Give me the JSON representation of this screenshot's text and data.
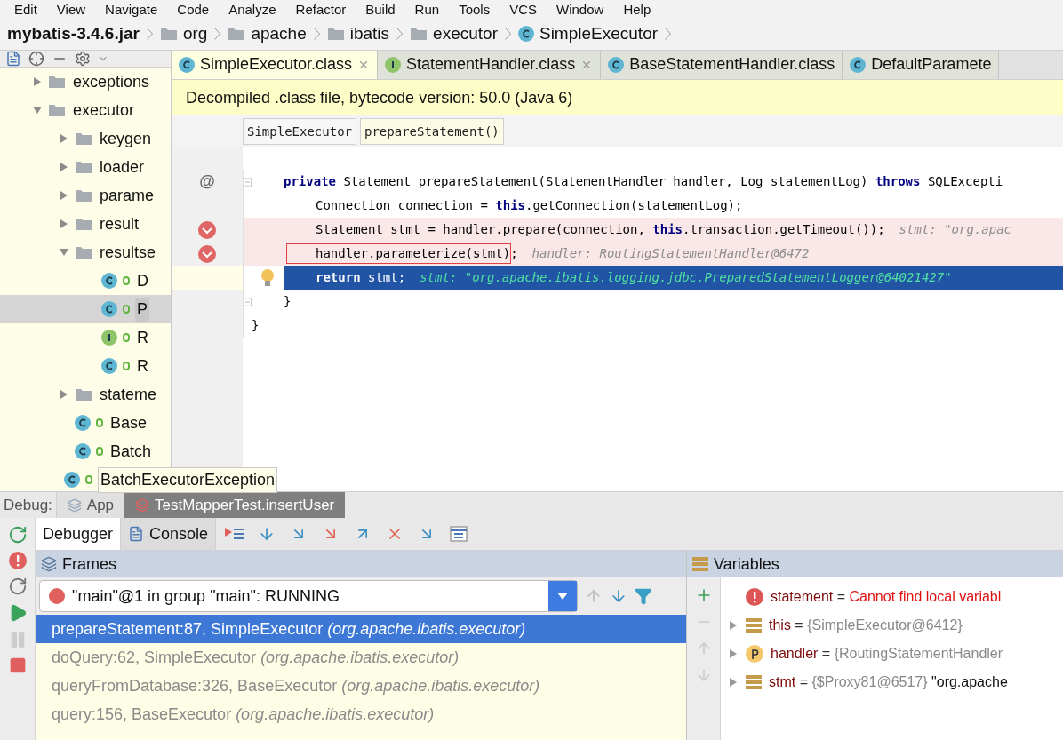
{
  "menu": [
    "Edit",
    "View",
    "Navigate",
    "Code",
    "Analyze",
    "Refactor",
    "Build",
    "Run",
    "Tools",
    "VCS",
    "Window",
    "Help"
  ],
  "breadcrumbs": [
    {
      "label": "mybatis-3.4.6.jar",
      "kind": "jar"
    },
    {
      "label": "org",
      "kind": "folder"
    },
    {
      "label": "apache",
      "kind": "folder"
    },
    {
      "label": "ibatis",
      "kind": "folder"
    },
    {
      "label": "executor",
      "kind": "folder"
    },
    {
      "label": "SimpleExecutor",
      "kind": "class"
    }
  ],
  "editor_tabs": [
    {
      "label": "SimpleExecutor.class",
      "kind": "class",
      "selected": true
    },
    {
      "label": "StatementHandler.class",
      "kind": "interface",
      "selected": false
    },
    {
      "label": "BaseStatementHandler.class",
      "kind": "class",
      "selected": false
    },
    {
      "label": "DefaultParamete",
      "kind": "class",
      "selected": false
    }
  ],
  "project_tree": [
    {
      "label": "exceptions",
      "kind": "folder",
      "expanded": false
    },
    {
      "label": "executor",
      "kind": "folder",
      "expanded": true,
      "children": [
        {
          "label": "keygen",
          "kind": "folder",
          "expanded": false
        },
        {
          "label": "loader",
          "kind": "folder",
          "expanded": false
        },
        {
          "label": "parame",
          "kind": "folder",
          "expanded": false
        },
        {
          "label": "result",
          "kind": "folder",
          "expanded": false
        },
        {
          "label": "resultse",
          "kind": "folder",
          "expanded": true,
          "children": [
            {
              "label": "D",
              "kind": "class",
              "selected": false
            },
            {
              "label": "P",
              "kind": "class",
              "selected": true
            },
            {
              "label": "R",
              "kind": "interface",
              "selected": false
            },
            {
              "label": "R",
              "kind": "class",
              "selected": false
            }
          ]
        },
        {
          "label": "stateme",
          "kind": "folder",
          "expanded": false
        },
        {
          "label": "Base",
          "kind": "class",
          "selected": false
        },
        {
          "label": "Batch",
          "kind": "class",
          "selected": false
        },
        {
          "label": "BatchExecutorException",
          "kind": "class",
          "selected": false
        }
      ]
    }
  ],
  "banner": "Decompiled .class file, bytecode version: 50.0 (Java 6)",
  "editor_breadcrumbs": [
    {
      "label": "SimpleExecutor",
      "selected": false
    },
    {
      "label": "prepareStatement()",
      "selected": true
    }
  ],
  "code_lines": [
    {
      "kind": "method",
      "marker": "@",
      "fold": true,
      "breakpoint": false,
      "current": false,
      "boxed": false,
      "text": "**private** Statement prepareStatement(StatementHandler handler, Log statementLog) **throws** SQLExcepti"
    },
    {
      "kind": "statement",
      "fold": false,
      "breakpoint": false,
      "current": false,
      "boxed": false,
      "text": "Connection connection = **this**.getConnection(statementLog);"
    },
    {
      "kind": "statement",
      "fold": false,
      "breakpoint": true,
      "current": false,
      "boxed": false,
      "text": "Statement stmt = handler.prepare(connection, **this**.transaction.getTimeout());",
      "hint": "stmt: \"org.apac"
    },
    {
      "kind": "statement",
      "fold": false,
      "breakpoint": true,
      "current": false,
      "boxed": true,
      "text": "handler.parameterize(stmt)",
      "tail": ";",
      "hint": "handler: RoutingStatementHandler@6472"
    },
    {
      "kind": "statement",
      "fold": false,
      "breakpoint": false,
      "current": true,
      "boxed": false,
      "text": "**return** stmt;",
      "hint": "stmt: \"org.apache.ibatis.logging.jdbc.PreparedStatementLogger@64021427\""
    },
    {
      "kind": "method",
      "fold": true,
      "breakpoint": false,
      "current": false,
      "boxed": false,
      "text": "}"
    },
    {
      "kind": "class",
      "fold": false,
      "breakpoint": false,
      "current": false,
      "boxed": false,
      "text": "}"
    }
  ],
  "debug": {
    "label": "Debug:",
    "sessions": [
      {
        "label": "App",
        "selected": false
      },
      {
        "label": "TestMapperTest.insertUser",
        "selected": true
      }
    ],
    "tabs": [
      {
        "label": "Debugger",
        "selected": true
      },
      {
        "label": "Console",
        "selected": false
      }
    ],
    "frames_title": "Frames",
    "thread": "\"main\"@1 in group \"main\": RUNNING",
    "frames": [
      {
        "text": "prepareStatement:87, SimpleExecutor *(org.apache.ibatis.executor)*",
        "selected": true
      },
      {
        "text": "doQuery:62, SimpleExecutor *(org.apache.ibatis.executor)*",
        "selected": false
      },
      {
        "text": "queryFromDatabase:326, BaseExecutor *(org.apache.ibatis.executor)*",
        "selected": false
      },
      {
        "text": "query:156, BaseExecutor *(org.apache.ibatis.executor)*",
        "selected": false
      }
    ],
    "variables_title": "Variables",
    "variables": [
      {
        "kind": "error",
        "expandable": false,
        "name": "statement",
        "separator": "=",
        "value": "Cannot find local variabl"
      },
      {
        "kind": "field",
        "expandable": true,
        "name": "this",
        "separator": "=",
        "value": "{SimpleExecutor@6412}"
      },
      {
        "kind": "param",
        "expandable": true,
        "name": "handler",
        "separator": "=",
        "value": "{RoutingStatementHandler"
      },
      {
        "kind": "field",
        "expandable": true,
        "name": "stmt",
        "separator": "=",
        "value": "{$Proxy81@6517}",
        "extra": "\"org.apache"
      }
    ]
  }
}
